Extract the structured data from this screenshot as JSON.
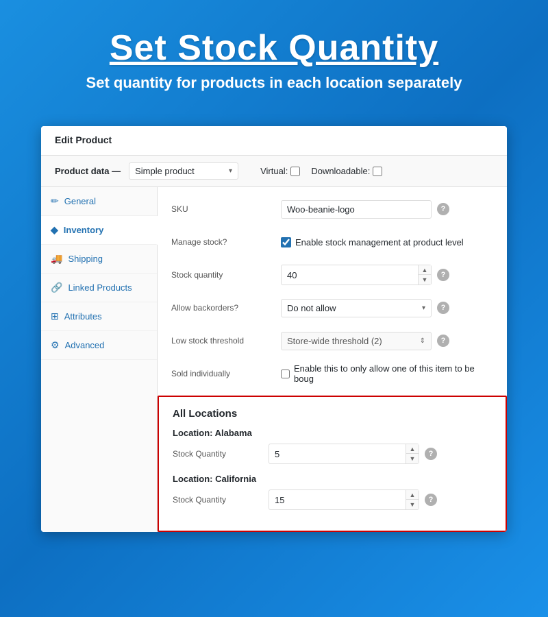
{
  "header": {
    "title": "Set Stock Quantity",
    "subtitle": "Set quantity for products in each location separately"
  },
  "panel": {
    "edit_product_label": "Edit Product",
    "product_data_label": "Product data —",
    "product_type": "Simple product",
    "virtual_label": "Virtual:",
    "downloadable_label": "Downloadable:"
  },
  "sidebar": {
    "items": [
      {
        "id": "general",
        "label": "General",
        "icon": "⚙"
      },
      {
        "id": "inventory",
        "label": "Inventory",
        "icon": "◇",
        "active": true
      },
      {
        "id": "shipping",
        "label": "Shipping",
        "icon": "🚚"
      },
      {
        "id": "linked-products",
        "label": "Linked Products",
        "icon": "🔗"
      },
      {
        "id": "attributes",
        "label": "Attributes",
        "icon": "⊞"
      },
      {
        "id": "advanced",
        "label": "Advanced",
        "icon": "⚙"
      }
    ]
  },
  "inventory": {
    "sku_label": "SKU",
    "sku_value": "Woo-beanie-logo",
    "manage_stock_label": "Manage stock?",
    "manage_stock_checkbox_label": "Enable stock management at product level",
    "stock_quantity_label": "Stock quantity",
    "stock_quantity_value": "40",
    "allow_backorders_label": "Allow backorders?",
    "allow_backorders_value": "Do not allow",
    "low_stock_threshold_label": "Low stock threshold",
    "low_stock_threshold_value": "Store-wide threshold (2)",
    "sold_individually_label": "Sold individually",
    "sold_individually_checkbox_label": "Enable this to only allow one of this item to be boug"
  },
  "locations": {
    "section_title": "All Locations",
    "items": [
      {
        "name": "Location: Alabama",
        "qty_label": "Stock Quantity",
        "qty_value": "5"
      },
      {
        "name": "Location: California",
        "qty_label": "Stock Quantity",
        "qty_value": "15"
      }
    ]
  },
  "icons": {
    "help": "?",
    "arrow_down": "▾",
    "arrow_up": "▴",
    "spinner_up": "▲",
    "spinner_down": "▼"
  }
}
